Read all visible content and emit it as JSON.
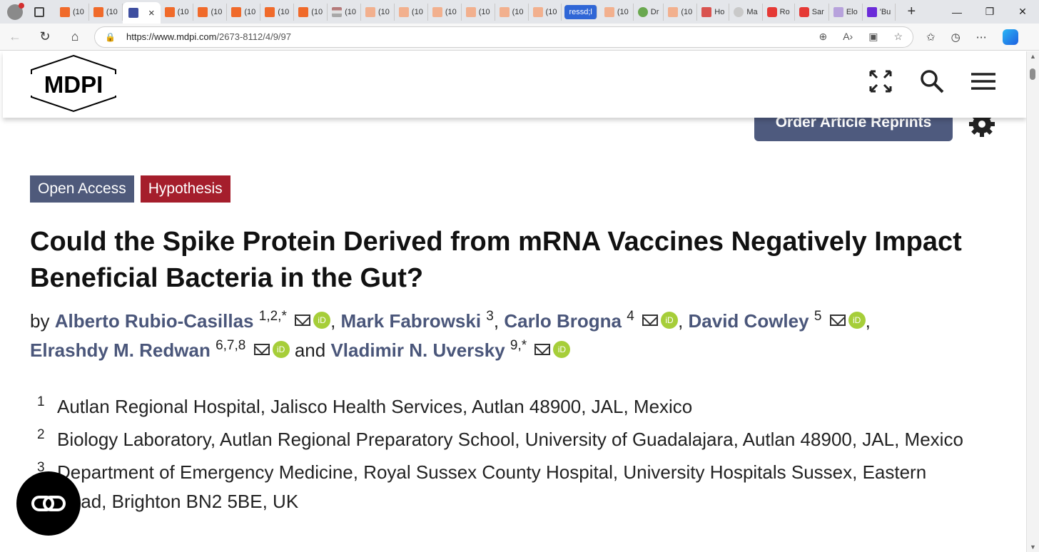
{
  "browser": {
    "tabs": [
      {
        "label": "(10",
        "icon": "substack-icon"
      },
      {
        "label": "(10",
        "icon": "substack-icon"
      },
      {
        "label": "",
        "icon": "mdpi-icon",
        "active": true,
        "close": "×"
      },
      {
        "label": "(10",
        "icon": "substack-icon"
      },
      {
        "label": "(10",
        "icon": "substack-icon"
      },
      {
        "label": "(10",
        "icon": "substack-icon"
      },
      {
        "label": "(10",
        "icon": "substack-icon"
      },
      {
        "label": "(10",
        "icon": "substack-icon"
      },
      {
        "label": "(10",
        "icon": "flag-icon"
      },
      {
        "label": "(10",
        "icon": "substack-icon"
      },
      {
        "label": "(10",
        "icon": "substack-icon"
      },
      {
        "label": "(10",
        "icon": "substack-icon"
      },
      {
        "label": "(10",
        "icon": "substack-icon"
      },
      {
        "label": "(10",
        "icon": "substack-icon"
      },
      {
        "label": "(10",
        "icon": "substack-icon"
      },
      {
        "label": "ressd;l",
        "icon": "",
        "highlight": true
      },
      {
        "label": "(10",
        "icon": "substack-icon"
      },
      {
        "label": "Dr",
        "icon": "play-icon"
      },
      {
        "label": "(10",
        "icon": "substack-icon"
      },
      {
        "label": "Ho",
        "icon": "pin-icon"
      },
      {
        "label": "Ma",
        "icon": "search-icon"
      },
      {
        "label": "Ro",
        "icon": "youtube-icon"
      },
      {
        "label": "Sar",
        "icon": "youtube-icon"
      },
      {
        "label": "Elo",
        "icon": "yahoo-icon"
      },
      {
        "label": "'Bu",
        "icon": "yahoo-icon"
      }
    ],
    "new_tab": "+",
    "window_controls": {
      "minimize": "—",
      "restore": "❐",
      "close": "✕"
    },
    "url_host": "https://www.mdpi.com",
    "url_path": "/2673-8112/4/9/97"
  },
  "site": {
    "logo_text": "MDPI",
    "order_reprints": "Order Article Reprints"
  },
  "article": {
    "badges": {
      "open_access": "Open Access",
      "type": "Hypothesis"
    },
    "title": "Could the Spike Protein Derived from mRNA Vaccines Negatively Impact Beneficial Bacteria in the Gut?",
    "by": "by",
    "and": "and",
    "authors": [
      {
        "name": "Alberto Rubio-Casillas",
        "sup": "1,2,*"
      },
      {
        "name": "Mark Fabrowski",
        "sup": "3"
      },
      {
        "name": "Carlo Brogna",
        "sup": "4"
      },
      {
        "name": "David Cowley",
        "sup": "5"
      },
      {
        "name": "Elrashdy M. Redwan",
        "sup": "6,7,8"
      },
      {
        "name": "Vladimir N. Uversky",
        "sup": "9,*"
      }
    ],
    "orcid_label": "iD",
    "affiliations": [
      {
        "num": "1",
        "text": "Autlan Regional Hospital, Jalisco Health Services, Autlan 48900, JAL, Mexico"
      },
      {
        "num": "2",
        "text": "Biology Laboratory, Autlan Regional Preparatory School, University of Guadalajara, Autlan 48900, JAL, Mexico"
      },
      {
        "num": "3",
        "text": "Department of Emergency Medicine, Royal Sussex County Hospital, University Hospitals Sussex, Eastern Road, Brighton BN2 5BE, UK"
      }
    ]
  }
}
